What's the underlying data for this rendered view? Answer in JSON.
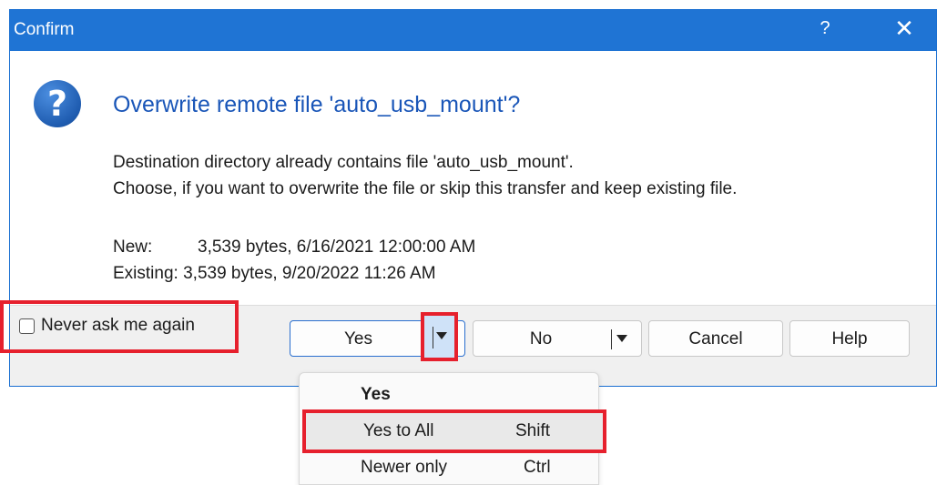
{
  "window": {
    "title": "Confirm",
    "help_glyph": "?",
    "close_glyph": "✕"
  },
  "icon": {
    "name": "question-icon",
    "glyph": "?",
    "color": "#1f5cb0"
  },
  "message": {
    "heading": "Overwrite remote file 'auto_usb_mount'?",
    "line1": "Destination directory already contains file 'auto_usb_mount'.",
    "line2": "Choose, if you want to overwrite the file or skip this transfer and keep existing file."
  },
  "file_info": {
    "new_label": "New:",
    "new_value": "3,539 bytes, 6/16/2021 12:00:00 AM",
    "existing_label": "Existing:",
    "existing_value": "3,539 bytes, 9/20/2022 11:26 AM"
  },
  "footer": {
    "never_ask_label": "Never ask me again",
    "never_ask_checked": false,
    "yes_label": "Yes",
    "no_label": "No",
    "cancel_label": "Cancel",
    "help_label": "Help"
  },
  "yes_menu": {
    "items": [
      {
        "label": "Yes",
        "shortcut": ""
      },
      {
        "label": "Yes to All",
        "shortcut": "Shift"
      },
      {
        "label": "Newer only",
        "shortcut": "Ctrl"
      }
    ]
  },
  "colors": {
    "titlebar": "#1f74d4",
    "heading": "#1a56b8",
    "highlight_red": "#e6202d"
  }
}
